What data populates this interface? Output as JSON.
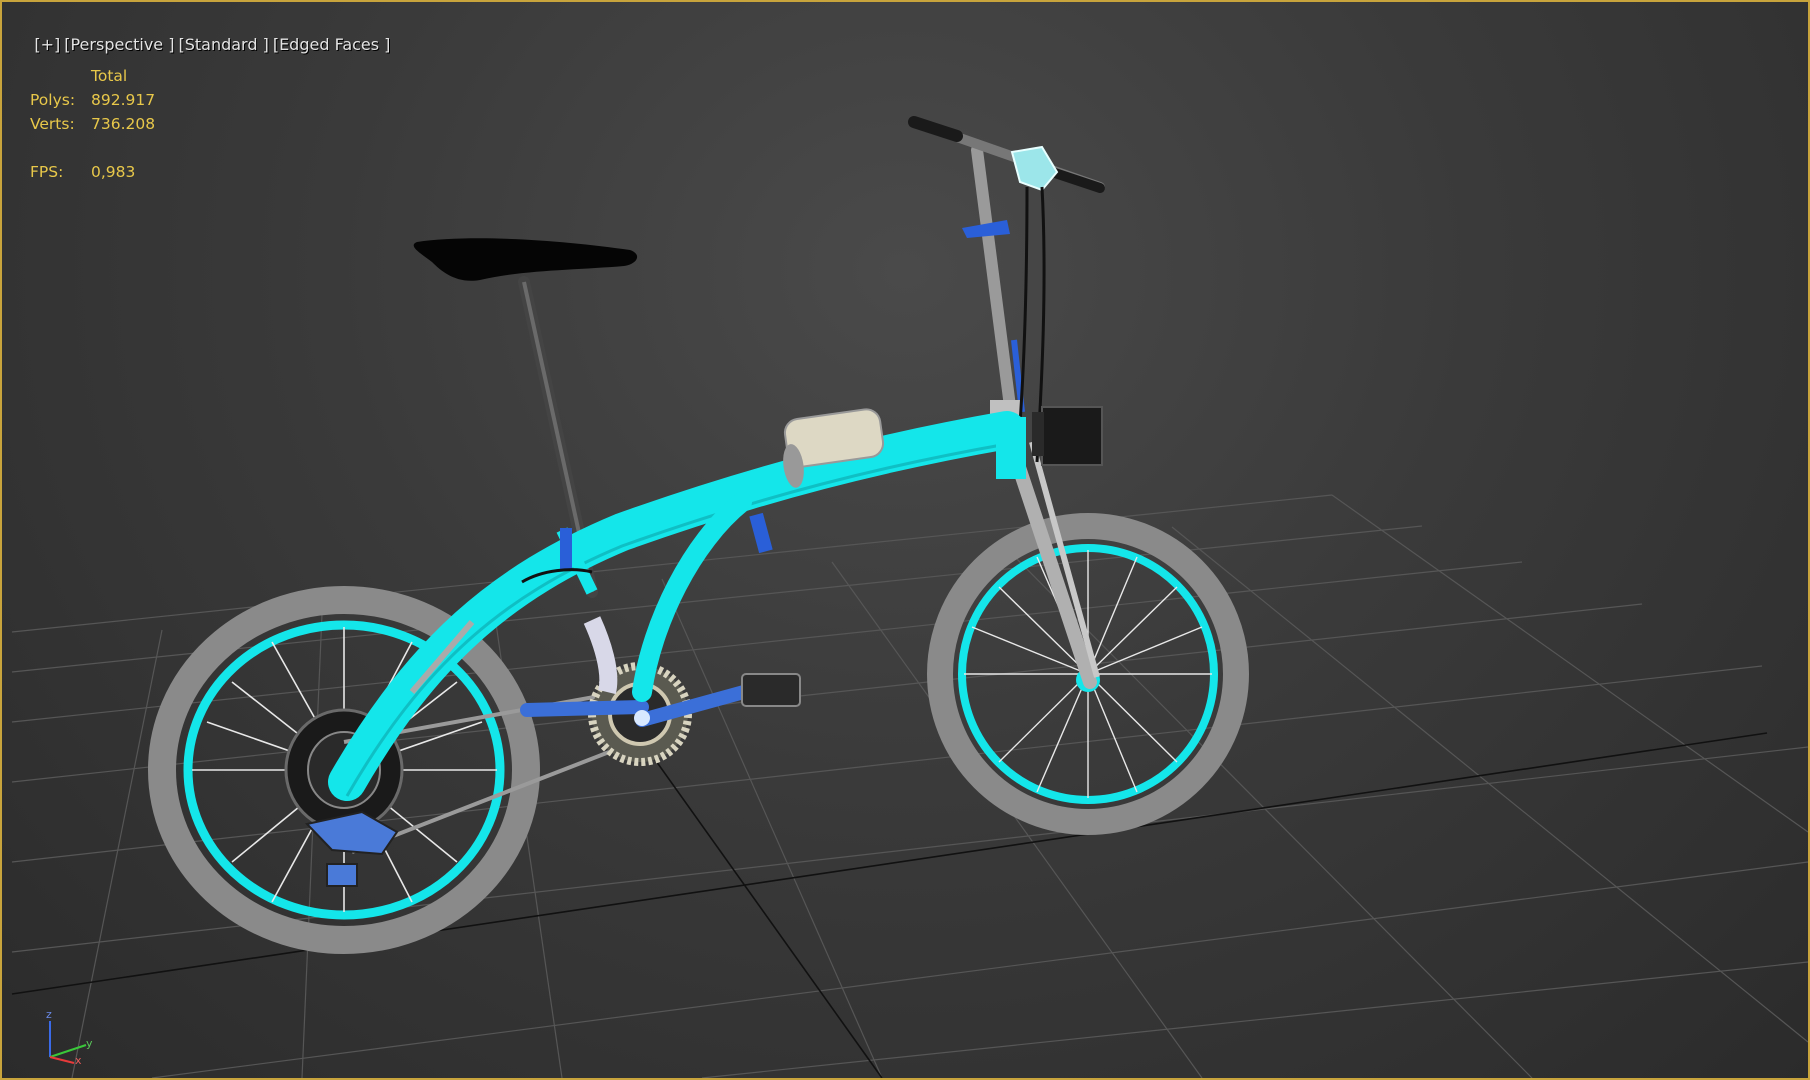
{
  "viewport": {
    "labels": [
      "[+]",
      "[Perspective ]",
      "[Standard ]",
      "[Edged Faces ]"
    ],
    "stats": {
      "header": "Total",
      "polys_label": "Polys:",
      "polys_value": "892.917",
      "verts_label": "Verts:",
      "verts_value": "736.208",
      "fps_label": "FPS:",
      "fps_value": "0,983"
    },
    "axis": {
      "z": "z",
      "y": "y",
      "x": "x"
    }
  },
  "colors": {
    "viewport_border": "#c8a43c",
    "stats_text": "#e8c84a",
    "frame_cyan": "#14e6ea",
    "tire_gray": "#8c8c8c",
    "component_blue": "#2a5fd8",
    "grid_line": "#5a5a5a"
  }
}
